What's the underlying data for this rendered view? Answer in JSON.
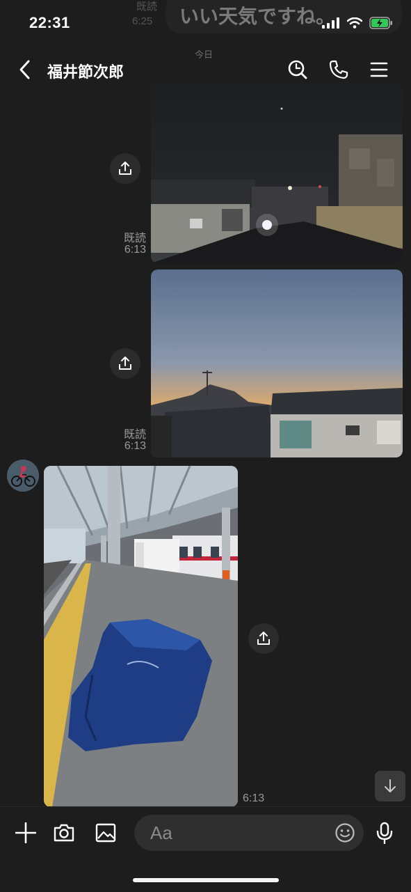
{
  "status_bar": {
    "time": "22:31",
    "battery": "charging",
    "signal": "4 bars",
    "wifi": "on"
  },
  "previous_message": {
    "text": "いい天気ですね。",
    "read": "既読",
    "time": "6:25"
  },
  "date_separator": "今日",
  "header": {
    "title": "福井節次郎",
    "icons": [
      "back-chevron-icon",
      "search-icon",
      "phone-icon",
      "menu-icon"
    ]
  },
  "messages": [
    {
      "sender": "me",
      "kind": "photo",
      "subject": "night rooftops with distant lights",
      "read_label": "既読",
      "time": "6:13"
    },
    {
      "sender": "me",
      "kind": "photo",
      "subject": "dusk sky over rooftops",
      "read_label": "既読",
      "time": "6:13"
    },
    {
      "sender": "friend",
      "kind": "photo",
      "subject": "train platform with covered bicycle",
      "time": "6:13"
    }
  ],
  "input": {
    "placeholder": "Aa"
  },
  "toolbar_icons": [
    "plus-icon",
    "camera-icon",
    "gallery-icon",
    "emoji-icon",
    "microphone-icon"
  ],
  "colors": {
    "background": "#1d1d1d",
    "bubble": "#2b2b2b",
    "battery": "#34c759"
  }
}
